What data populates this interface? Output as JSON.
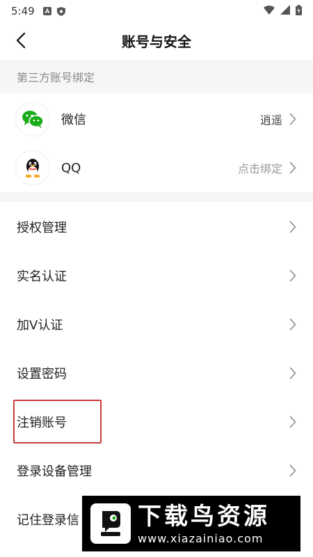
{
  "status_bar": {
    "time": "5:49",
    "left_icons": [
      "notification-a-icon",
      "shield-icon"
    ],
    "right_icons": [
      "wifi-icon",
      "signal-icon",
      "battery-icon"
    ]
  },
  "nav": {
    "title": "账号与安全",
    "back_icon": "back-arrow-icon"
  },
  "third_party": {
    "header": "第三方账号绑定",
    "items": [
      {
        "label": "微信",
        "value": "逍遥",
        "icon": "wechat-icon"
      },
      {
        "label": "QQ",
        "value": "点击绑定",
        "icon": "qq-icon"
      }
    ]
  },
  "menu": {
    "items": [
      {
        "label": "授权管理"
      },
      {
        "label": "实名认证"
      },
      {
        "label": "加V认证"
      },
      {
        "label": "设置密码"
      },
      {
        "label": "注销账号"
      },
      {
        "label": "登录设备管理"
      },
      {
        "label": "记住登录信"
      }
    ]
  },
  "watermark": {
    "title": "下载鸟资源",
    "url": "www.xiazainiao.com"
  },
  "colors": {
    "highlight": "#c63c3c",
    "wechat": "#1aad19",
    "section_bg": "#f6f6f6"
  }
}
